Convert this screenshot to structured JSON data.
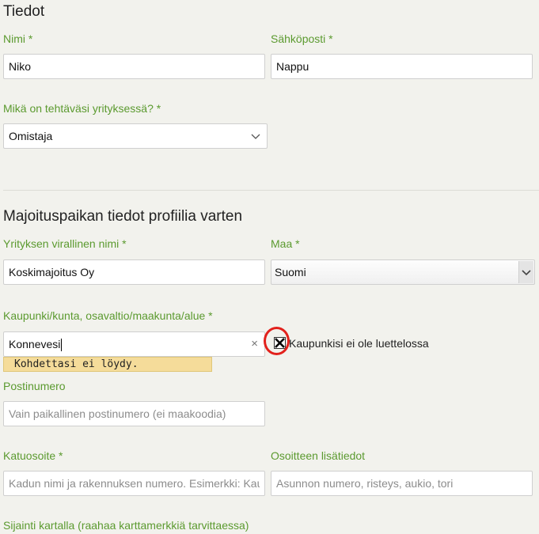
{
  "section1": {
    "heading": "Tiedot",
    "name_label": "Nimi *",
    "name_value": "Niko",
    "email_label": "Sähköposti *",
    "email_value": "Nappu",
    "role_label": "Mikä on tehtäväsi yrityksessä? *",
    "role_value": "Omistaja"
  },
  "section2": {
    "heading": "Majoituspaikan tiedot profiilia varten",
    "company_label": "Yrityksen virallinen nimi *",
    "company_value": "Koskimajoitus Oy",
    "country_label": "Maa *",
    "country_value": "Suomi",
    "city_label": "Kaupunki/kunta, osavaltio/maakunta/alue *",
    "city_value": "Konnevesi",
    "city_clear": "×",
    "not_found_message": "Kohdettasi ei löydy.",
    "city_not_listed_label": "Kaupunkisi ei ole luettelossa",
    "postal_label": "Postinumero",
    "postal_placeholder": "Vain paikallinen postinumero (ei maakoodia)",
    "street_label": "Katuosoite *",
    "street_placeholder": "Kadun nimi ja rakennuksen numero. Esimerkki: Kau",
    "extra_label": "Osoitteen lisätiedot",
    "extra_placeholder": "Asunnon numero, risteys, aukio, tori",
    "map_label": "Sijainti kartalla (raahaa karttamerkkiä tarvittaessa)"
  },
  "colors": {
    "label_green": "#5b9a2f",
    "highlight_ring": "#e2211c",
    "warning_bg": "#f5dc9a"
  },
  "icons": {
    "role_dropdown": "chevron-down-icon",
    "country_dropdown": "chevron-down-icon",
    "checkbox_state": "checked-x"
  }
}
